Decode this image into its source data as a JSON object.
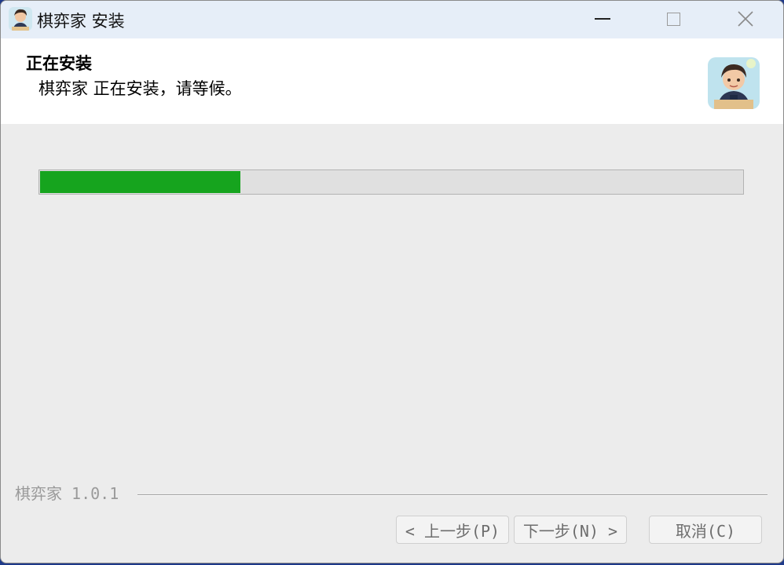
{
  "window": {
    "title": "棋弈家 安装"
  },
  "header": {
    "title": "正在安装",
    "subtitle": "棋弈家 正在安装，请等候。"
  },
  "progress": {
    "value_fraction": 0.285,
    "fill_color": "#16a41e"
  },
  "footer": {
    "brand": "棋弈家 1.0.1",
    "back_label": "< 上一步(P)",
    "next_label": "下一步(N) >",
    "cancel_label": "取消(C)"
  },
  "icons": {
    "app": "avatar-boy-icon",
    "minimize": "minimize-icon",
    "maximize": "maximize-icon",
    "close": "close-icon",
    "logo": "avatar-boy-icon"
  }
}
